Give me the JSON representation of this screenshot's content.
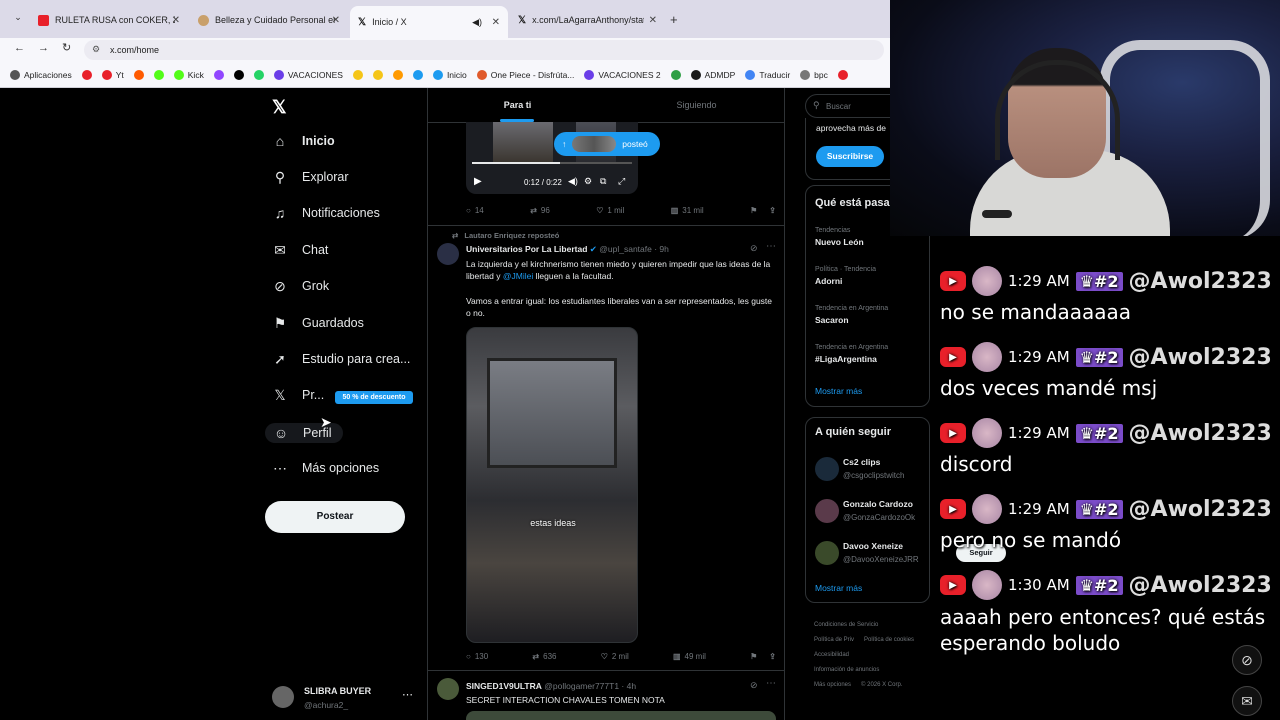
{
  "browser": {
    "tabs": [
      {
        "title": "RULETA RUSA con COKER, ZEK",
        "icon_color": "#e8202a"
      },
      {
        "title": "Belleza y Cuidado Personal en",
        "icon_color": "#c9a06b"
      },
      {
        "title": "Inicio / X",
        "icon_color": "#000000"
      },
      {
        "title": "x.com/LaAgarraAnthony/status",
        "icon_color": "#000000"
      }
    ],
    "url": "x.com/home",
    "bookmarks": [
      {
        "label": "Aplicaciones",
        "color": "#555"
      },
      {
        "label": "",
        "color": "#e8202a"
      },
      {
        "label": "Yt",
        "color": "#e8202a"
      },
      {
        "label": "",
        "color": "#ff5a00"
      },
      {
        "label": "",
        "color": "#53fc18"
      },
      {
        "label": "Kick",
        "color": "#53fc18"
      },
      {
        "label": "",
        "color": "#9146ff"
      },
      {
        "label": "",
        "color": "#000"
      },
      {
        "label": "",
        "color": "#25d366"
      },
      {
        "label": "VACACIONES",
        "color": "#6a3de8"
      },
      {
        "label": "",
        "color": "#f5c518"
      },
      {
        "label": "",
        "color": "#f5c518"
      },
      {
        "label": "",
        "color": "#ff9a00"
      },
      {
        "label": "",
        "color": "#1d9bf0"
      },
      {
        "label": "Inicio",
        "color": "#1d9bf0"
      },
      {
        "label": "One Piece - Disfrúta...",
        "color": "#e05a2b"
      },
      {
        "label": "VACACIONES 2",
        "color": "#6a3de8"
      },
      {
        "label": "",
        "color": "#2e9e44"
      },
      {
        "label": "ADMDP",
        "color": "#1a1a1a"
      },
      {
        "label": "Traducir",
        "color": "#4285f4"
      },
      {
        "label": "bpc",
        "color": "#777"
      },
      {
        "label": "",
        "color": "#e8202a"
      }
    ]
  },
  "nav": {
    "items": [
      {
        "label": "Inicio",
        "icon": "home-icon",
        "glyph": "⌂"
      },
      {
        "label": "Explorar",
        "icon": "search-icon",
        "glyph": "⚲"
      },
      {
        "label": "Notificaciones",
        "icon": "bell-icon",
        "glyph": "♫"
      },
      {
        "label": "Chat",
        "icon": "mail-icon",
        "glyph": "✉"
      },
      {
        "label": "Grok",
        "icon": "grok-icon",
        "glyph": "⊘"
      },
      {
        "label": "Guardados",
        "icon": "bookmark-icon",
        "glyph": "⚑"
      },
      {
        "label": "Estudio para crea...",
        "icon": "rocket-icon",
        "glyph": "➚"
      },
      {
        "label": "Pr...",
        "icon": "x-premium-icon",
        "glyph": "𝕏"
      },
      {
        "label": "Perfil",
        "icon": "profile-icon",
        "glyph": "☺"
      },
      {
        "label": "Más opciones",
        "icon": "more-icon",
        "glyph": "⋯"
      }
    ],
    "premium_badge": "50 % de descuento",
    "post_button": "Postear",
    "account": {
      "name": "SLIBRA BUYER",
      "handle": "@achura2_"
    }
  },
  "feed": {
    "tabs": [
      "Para ti",
      "Siguiendo"
    ],
    "video1": {
      "time": "0:12 / 0:22",
      "toast": "posteó"
    },
    "tweet1_actions": {
      "replies": "14",
      "reposts": "96",
      "likes": "1 mil",
      "views": "31 mil"
    },
    "tweet2": {
      "repost_note": "Lautaro Enriquez reposteó",
      "author": "Universitarios Por La Libertad",
      "handle": "@upl_santafe · 9h",
      "text1": "La izquierda y el kirchnerismo tienen miedo y quieren impedir que las ideas de la libertad y",
      "mention": "@JMilei",
      "text1b": "lleguen a la facultad.",
      "text2": "Vamos a entrar igual: los estudiantes liberales van a ser representados, les guste o no.",
      "video_caption": "estas ideas",
      "actions": {
        "replies": "130",
        "reposts": "636",
        "likes": "2 mil",
        "views": "49 mil"
      }
    },
    "tweet3": {
      "author": "SINGED1V9ULTRA",
      "handle": "@pollogamer777T1 · 4h",
      "text": "SECRET INTERACTION CHAVALES TOMEN NOTA"
    }
  },
  "sidebar": {
    "search_placeholder": "Buscar",
    "premium_text": "aprovecha más de",
    "subscribe": "Suscribirse",
    "trends_title": "Qué está pasa",
    "trends": [
      {
        "context": "Tendencias",
        "name": "Nuevo León"
      },
      {
        "context": "Política · Tendencia",
        "name": "Adorni"
      },
      {
        "context": "Tendencia en Argentina",
        "name": "Sacaron"
      },
      {
        "context": "Tendencia en Argentina",
        "name": "#LigaArgentina"
      }
    ],
    "show_more": "Mostrar más",
    "follow_title": "A quién seguir",
    "follow": [
      {
        "name": "Cs2 clips",
        "handle": "@csgoclipstwitch"
      },
      {
        "name": "Gonzalo Cardozo",
        "handle": "@GonzaCardozoOk"
      },
      {
        "name": "Davoo Xeneize",
        "handle": "@DavooXeneizeJRR"
      }
    ],
    "follow_button": "Seguir",
    "show_more2": "Mostrar más",
    "footer": [
      "Condiciones de Servicio",
      "Política de Priv",
      "Política de cookies",
      "Accesibilidad",
      "Información de anuncios",
      "Más opciones",
      "© 2026 X Corp."
    ]
  },
  "chat": {
    "messages": [
      {
        "time": "1:29 AM",
        "badge": "#2",
        "user": "@Awol2323",
        "text": "no se mandaaaaaa"
      },
      {
        "time": "1:29 AM",
        "badge": "#2",
        "user": "@Awol2323",
        "text": "dos veces mandé msj"
      },
      {
        "time": "1:29 AM",
        "badge": "#2",
        "user": "@Awol2323",
        "text": "discord"
      },
      {
        "time": "1:29 AM",
        "badge": "#2",
        "user": "@Awol2323",
        "text": "pero no se mandó"
      },
      {
        "time": "1:30 AM",
        "badge": "#2",
        "user": "@Awol2323",
        "text": "aaaah pero entonces? qué estás esperando boludo"
      }
    ]
  }
}
